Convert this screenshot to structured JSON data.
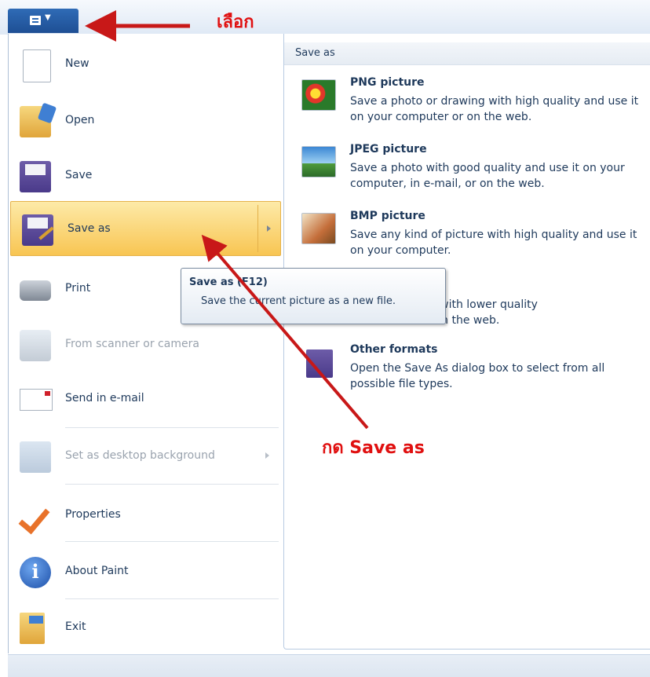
{
  "app_button": {
    "icon": "menu-icon"
  },
  "annotations": {
    "choose": "เลือก",
    "press": "กด  Save as"
  },
  "menu": {
    "items": [
      {
        "label": "New",
        "icon": "new-document-icon"
      },
      {
        "label": "Open",
        "icon": "open-folder-icon"
      },
      {
        "label": "Save",
        "icon": "save-disk-icon"
      },
      {
        "label": "Save as",
        "icon": "save-as-icon"
      },
      {
        "label": "Print",
        "icon": "printer-icon"
      },
      {
        "label": "From scanner or camera",
        "icon": "scanner-icon"
      },
      {
        "label": "Send in e-mail",
        "icon": "email-icon"
      },
      {
        "label": "Set as desktop background",
        "icon": "desktop-icon"
      },
      {
        "label": "Properties",
        "icon": "checkmark-icon"
      },
      {
        "label": "About Paint",
        "icon": "info-icon"
      },
      {
        "label": "Exit",
        "icon": "exit-icon"
      }
    ]
  },
  "save_as_panel": {
    "header": "Save as",
    "options": [
      {
        "title": "PNG picture",
        "desc": "Save a photo or drawing with high quality and use it on your computer or on the web."
      },
      {
        "title": "JPEG picture",
        "desc": "Save a photo with good quality and use it on your computer, in e-mail, or on the web."
      },
      {
        "title": "BMP picture",
        "desc": "Save any kind of picture with high quality and use it on your computer."
      },
      {
        "title": "",
        "desc": "awing with lower quality\nail or on the web."
      },
      {
        "title": "Other formats",
        "desc": "Open the Save As dialog box to select from all possible file types."
      }
    ]
  },
  "tooltip": {
    "title": "Save as (F12)",
    "text": "Save the current picture as a new file."
  },
  "colors": {
    "annotation_red": "#e01010",
    "selected_bg": "#f8c552",
    "app_button": "#2f6bb6"
  }
}
